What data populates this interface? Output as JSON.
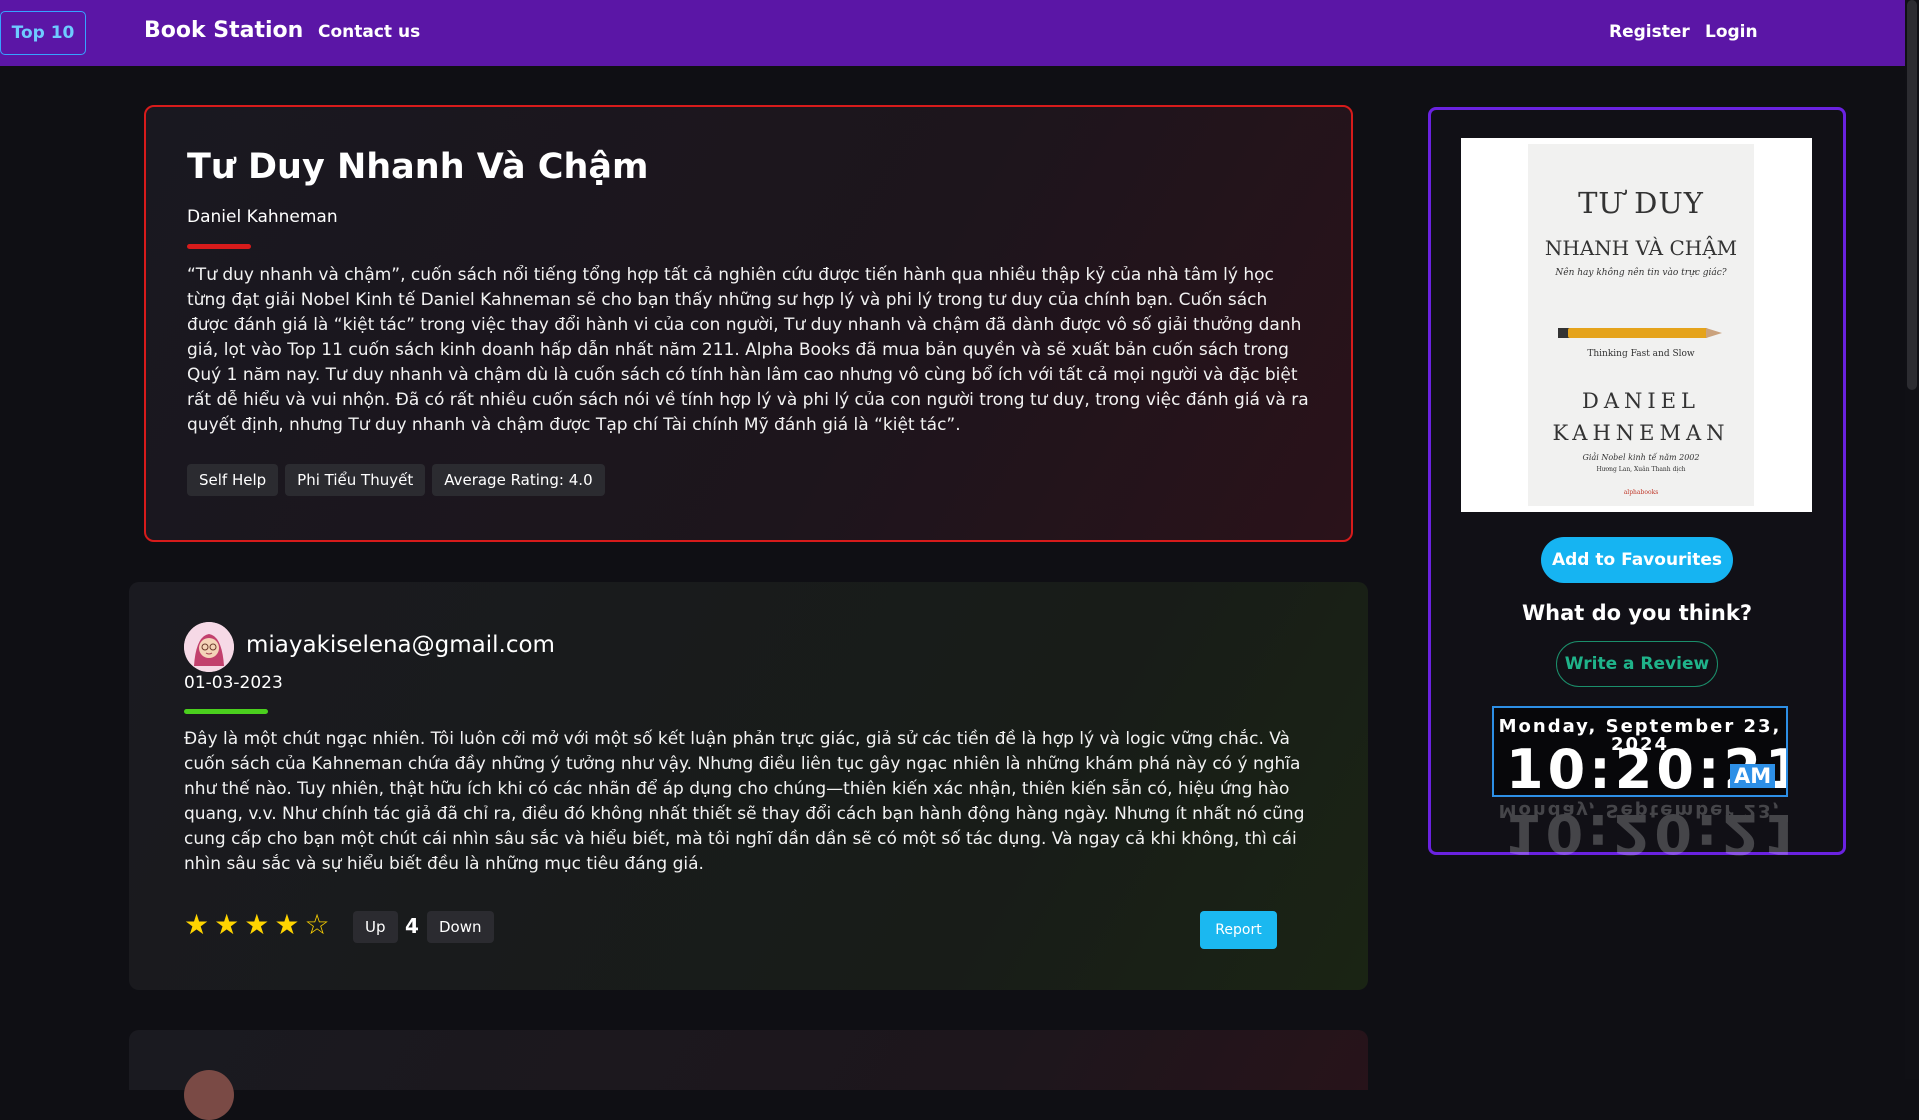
{
  "nav": {
    "brand": "Book Station",
    "contact": "Contact us",
    "top10": "Top 10",
    "register": "Register",
    "login": "Login"
  },
  "book": {
    "title": "Tư Duy Nhanh Và Chậm",
    "author": "Daniel Kahneman",
    "description": "“Tư duy nhanh và chậm”, cuốn sách nổi tiếng tổng hợp tất cả nghiên cứu được tiến hành qua nhiều thập kỷ của nhà tâm lý học từng đạt giải Nobel Kinh tế Daniel Kahneman sẽ cho bạn thấy những sư hợp lý và phi lý trong tư duy của chính bạn. Cuốn sách được đánh giá là “kiệt tác” trong việc thay đổi hành vi của con người, Tư duy nhanh và chậm đã dành được vô số giải thưởng danh giá, lọt vào Top 11 cuốn sách kinh doanh hấp dẫn nhất năm 211. Alpha Books đã mua bản quyền và sẽ xuất bản cuốn sách trong Quý 1 năm nay. Tư duy nhanh và chậm dù là cuốn sách có tính hàn lâm cao nhưng vô cùng bổ ích với tất cả mọi người và đặc biệt rất dễ hiểu và vui nhộn. Đã có rất nhiều cuốn sách nói về tính hợp lý và phi lý của con người trong tư duy, trong việc đánh giá và ra quyết định, nhưng Tư duy nhanh và chậm được Tạp chí Tài chính Mỹ đánh giá là “kiệt tác”.",
    "tags": [
      "Self Help",
      "Phi Tiểu Thuyết",
      "Average Rating: 4.0"
    ]
  },
  "review": {
    "email": "miayakiselena@gmail.com",
    "date": "01-03-2023",
    "text": "Đây là một chút ngạc nhiên. Tôi luôn cởi mở với một số kết luận phản trực giác, giả sử các tiền đề là hợp lý và logic vững chắc. Và cuốn sách của Kahneman chứa đầy những ý tưởng như vậy. Nhưng điều liên tục gây ngạc nhiên là những khám phá này có ý nghĩa như thế nào. Tuy nhiên, thật hữu ích khi có các nhãn để áp dụng cho chúng—thiên kiến xác nhận, thiên kiến sẵn có, hiệu ứng hào quang, v.v. Như chính tác giả đã chỉ ra, điều đó không nhất thiết sẽ thay đổi cách bạn hành động hàng ngày. Nhưng ít nhất nó cũng cung cấp cho bạn một chút cái nhìn sâu sắc và hiểu biết, mà tôi nghĩ dần dần sẽ có một số tác dụng. Và ngay cả khi không, thì cái nhìn sâu sắc và sự hiểu biết đều là những mục tiêu đáng giá.",
    "rating": 4,
    "rating_max": 5,
    "up_label": "Up",
    "votes": "4",
    "down_label": "Down",
    "report_label": "Report"
  },
  "sidebar": {
    "cover": {
      "title_line1": "TƯ DUY",
      "title_line2": "NHANH VÀ CHẬM",
      "subtitle": "Nên hay không nên tin vào trực giác?",
      "english_title": "Thinking Fast and Slow",
      "author_line1": "DANIEL",
      "author_line2": "KAHNEMAN",
      "award": "Giải Nobel kinh tế năm 2002",
      "translators": "Hương Lan, Xuân Thanh dịch",
      "publisher": "alphabooks"
    },
    "favourite_label": "Add to Favourites",
    "prompt": "What do you think?",
    "write_label": "Write a Review",
    "clock": {
      "date": "Monday, September 23, 2024",
      "time": "10:20:21",
      "ampm": "AM"
    }
  },
  "colors": {
    "navbar": "#5b16a6",
    "accent_red": "#d71b1b",
    "accent_green": "#4bcf1e",
    "sidebar_border": "#6a22e0",
    "primary_button": "#16b4f2",
    "star": "#ffd400"
  }
}
